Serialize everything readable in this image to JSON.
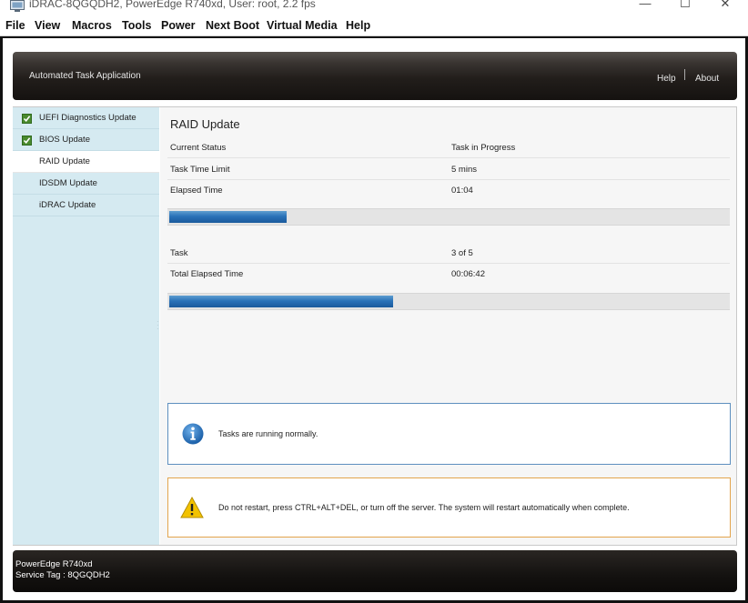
{
  "window": {
    "title": "iDRAC-8QGQDH2, PowerEdge R740xd, User: root, 2.2 fps",
    "minimize_glyph": "—",
    "maximize_glyph": "☐",
    "close_glyph": "✕"
  },
  "menubar": {
    "items": [
      "File",
      "View",
      "Macros",
      "Tools",
      "Power",
      "Next Boot",
      "Virtual Media",
      "Help"
    ]
  },
  "header": {
    "app_title": "Automated Task Application",
    "help_label": "Help",
    "separator": "|",
    "about_label": "About"
  },
  "sidebar": {
    "items": [
      {
        "label": "UEFI Diagnostics Update",
        "checked": true,
        "active": false
      },
      {
        "label": "BIOS Update",
        "checked": true,
        "active": false
      },
      {
        "label": "RAID Update",
        "checked": false,
        "active": true
      },
      {
        "label": "IDSDM Update",
        "checked": false,
        "active": false
      },
      {
        "label": "iDRAC Update",
        "checked": false,
        "active": false
      }
    ]
  },
  "main": {
    "title": "RAID Update",
    "current_status_label": "Current Status",
    "current_status_value": "Task in Progress",
    "time_limit_label": "Task Time Limit",
    "time_limit_value": "5 mins",
    "elapsed_label": "Elapsed Time",
    "elapsed_value": "01:04",
    "task_progress_fraction": 0.21,
    "task_label": "Task",
    "task_value": "3 of 5",
    "total_elapsed_label": "Total Elapsed Time",
    "total_elapsed_value": "00:06:42",
    "overall_progress_fraction": 0.4
  },
  "messages": {
    "info_text": "Tasks are running normally.",
    "warning_text": "Do not restart, press CTRL+ALT+DEL, or turn off the server.  The system will restart automatically when complete.",
    "info_color": "#1f6fb8",
    "warning_color": "#f2c200"
  },
  "footer": {
    "model": "PowerEdge R740xd",
    "service_tag": "Service Tag : 8QGQDH2"
  }
}
